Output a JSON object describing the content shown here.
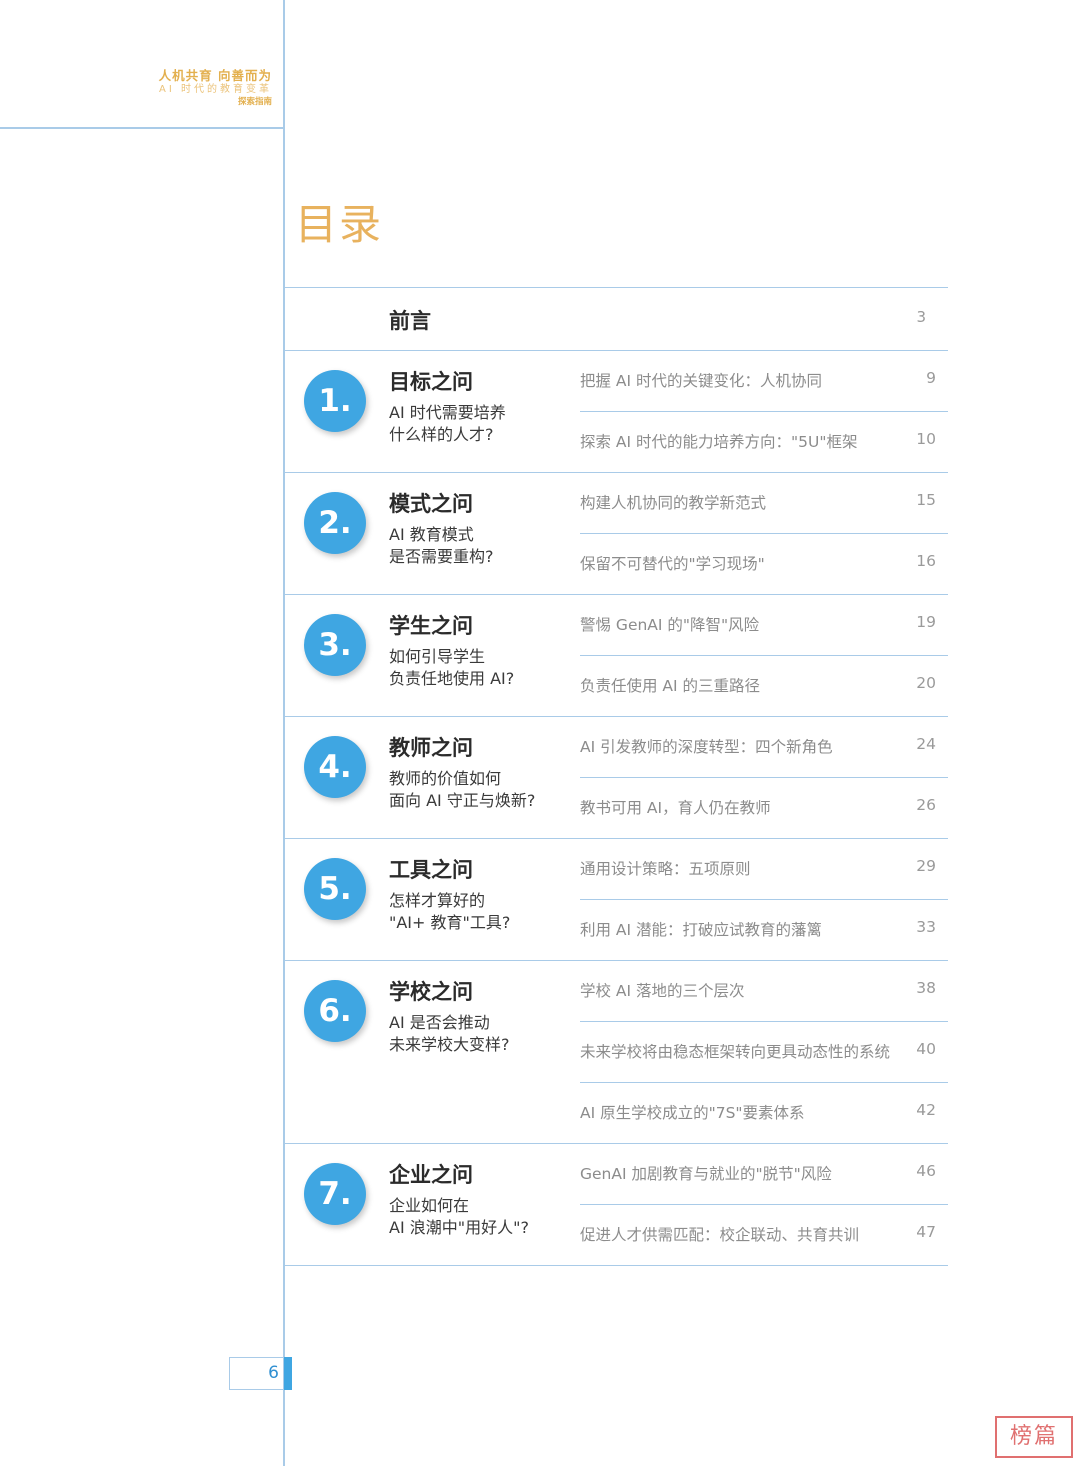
{
  "header": {
    "line1": "人机共育  向善而为",
    "line2": "AI 时代的教育变革",
    "line3": "探索指南"
  },
  "toc_title": "目录",
  "preface": {
    "title": "前言",
    "page": "3"
  },
  "sections": [
    {
      "num": "1.",
      "title": "目标之问",
      "subtitle": [
        "AI 时代需要培养",
        "什么样的人才?"
      ],
      "items": [
        {
          "text": "把握 AI 时代的关键变化：人机协同",
          "page": "9"
        },
        {
          "text": "探索 AI 时代的能力培养方向：\"5U\"框架",
          "page": "10"
        }
      ]
    },
    {
      "num": "2.",
      "title": "模式之问",
      "subtitle": [
        "AI 教育模式",
        "是否需要重构?"
      ],
      "items": [
        {
          "text": "构建人机协同的教学新范式",
          "page": "15"
        },
        {
          "text": "保留不可替代的\"学习现场\"",
          "page": "16"
        }
      ]
    },
    {
      "num": "3.",
      "title": "学生之问",
      "subtitle": [
        "如何引导学生",
        "负责任地使用 AI?"
      ],
      "items": [
        {
          "text": "警惕 GenAI 的\"降智\"风险",
          "page": "19"
        },
        {
          "text": "负责任使用 AI 的三重路径",
          "page": "20"
        }
      ]
    },
    {
      "num": "4.",
      "title": "教师之问",
      "subtitle": [
        "教师的价值如何",
        "面向 AI 守正与焕新?"
      ],
      "items": [
        {
          "text": "AI 引发教师的深度转型：四个新角色",
          "page": "24"
        },
        {
          "text": "教书可用 AI，育人仍在教师",
          "page": "26"
        }
      ]
    },
    {
      "num": "5.",
      "title": "工具之问",
      "subtitle": [
        "怎样才算好的",
        "\"AI+ 教育\"工具?"
      ],
      "items": [
        {
          "text": "通用设计策略：五项原则",
          "page": "29"
        },
        {
          "text": "利用 AI 潜能：打破应试教育的藩篱",
          "page": "33"
        }
      ]
    },
    {
      "num": "6.",
      "title": "学校之问",
      "subtitle": [
        "AI 是否会推动",
        "未来学校大变样?"
      ],
      "items": [
        {
          "text": "学校 AI 落地的三个层次",
          "page": "38"
        },
        {
          "text": "未来学校将由稳态框架转向更具动态性的系统",
          "page": "40"
        },
        {
          "text": "AI 原生学校成立的\"7S\"要素体系",
          "page": "42"
        }
      ]
    },
    {
      "num": "7.",
      "title": "企业之问",
      "subtitle": [
        "企业如何在",
        "AI 浪潮中\"用好人\"?"
      ],
      "items": [
        {
          "text": "GenAI 加剧教育与就业的\"脱节\"风险",
          "page": "46"
        },
        {
          "text": "促进人才供需匹配：校企联动、共育共训",
          "page": "47"
        }
      ]
    }
  ],
  "page_number": "6",
  "stamp_text": "榜篇",
  "colors": {
    "accent_blue": "#3fa6e2",
    "gold": "#e3b04f",
    "rule": "#a9cbe8"
  }
}
